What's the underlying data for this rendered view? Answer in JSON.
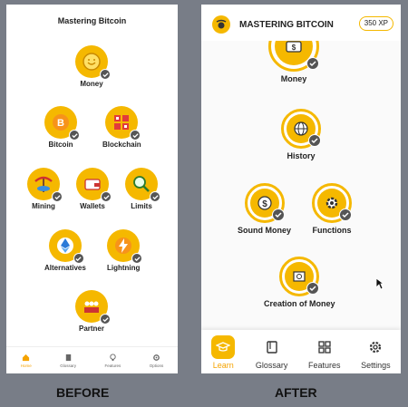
{
  "before": {
    "caption": "BEFORE",
    "title": "Mastering Bitcoin",
    "nodes": [
      "Money",
      "Bitcoin",
      "Blockchain",
      "Mining",
      "Wallets",
      "Limits",
      "Alternatives",
      "Lightning",
      "Partner"
    ],
    "tabs": [
      "Home",
      "Glossary",
      "Features",
      "Options"
    ]
  },
  "after": {
    "caption": "AFTER",
    "title": "MASTERING BITCOIN",
    "xp": "350 XP",
    "nodes": [
      "Money",
      "History",
      "Sound Money",
      "Functions",
      "Creation of Money"
    ],
    "tabs": [
      "Learn",
      "Glossary",
      "Features",
      "Settings"
    ]
  },
  "colors": {
    "accent": "#f5b800",
    "check": "#555555",
    "background": "#787d87"
  }
}
